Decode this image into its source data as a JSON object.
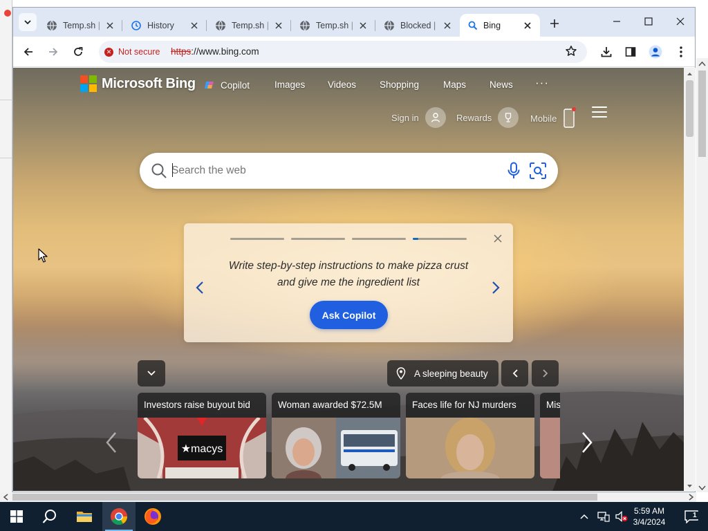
{
  "browser": {
    "tabs": [
      {
        "title": "Temp.sh |",
        "icon": "globe-icon",
        "active": false
      },
      {
        "title": "History",
        "icon": "history-icon",
        "active": false
      },
      {
        "title": "Temp.sh |",
        "icon": "globe-icon",
        "active": false
      },
      {
        "title": "Temp.sh |",
        "icon": "globe-icon",
        "active": false
      },
      {
        "title": "Blocked |",
        "icon": "globe-icon",
        "active": false
      },
      {
        "title": "Bing",
        "icon": "bing-search-icon",
        "active": true
      }
    ],
    "security_label": "Not secure",
    "url_scheme": "https",
    "url_rest": "://www.bing.com"
  },
  "bing": {
    "brand": "Microsoft Bing",
    "nav": [
      "Copilot",
      "Images",
      "Videos",
      "Shopping",
      "Maps",
      "News"
    ],
    "nav_more": "···",
    "sign_in": "Sign in",
    "rewards": "Rewards",
    "mobile": "Mobile",
    "search_placeholder": "Search the web",
    "copilot_prompt": "Write step-by-step instructions to make pizza crust and give me the ingredient list",
    "ask_copilot": "Ask Copilot",
    "promo_progress": {
      "total": 4,
      "current": 4
    },
    "image_title": "A sleeping beauty",
    "news": [
      {
        "caption": "Investors raise buyout bid",
        "thumb": "macys-store-image"
      },
      {
        "caption": "Woman awarded $72.5M",
        "thumb": "woman-and-bus-image"
      },
      {
        "caption": "Faces life for NJ murders",
        "thumb": "woman-mugshot-image"
      },
      {
        "caption": "Mis",
        "thumb": "partial-image"
      }
    ]
  },
  "taskbar": {
    "apps": [
      "start-button",
      "search-button",
      "file-explorer",
      "chrome",
      "firefox"
    ],
    "time": "5:59 AM",
    "date": "3/4/2024",
    "notification_count": "1"
  },
  "colors": {
    "accent_blue": "#1f5fe0",
    "insecure_red": "#c5221f",
    "tabstrip": "#dfe7f5",
    "taskbar": "#112031"
  }
}
